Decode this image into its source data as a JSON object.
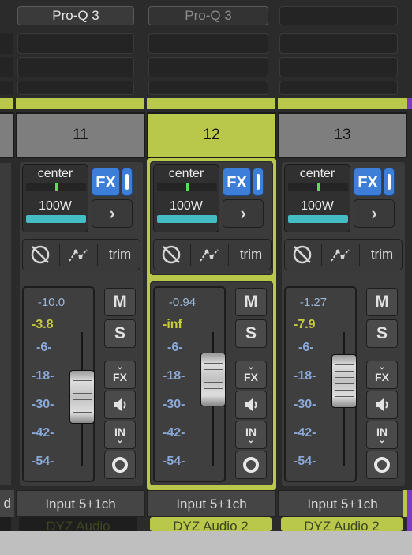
{
  "top_inserts": [
    {
      "name": "Pro-Q 3",
      "state": "active"
    },
    {
      "name": "Pro-Q 3",
      "state": "bypassed"
    }
  ],
  "channels": [
    {
      "number": "11",
      "pan": "center",
      "volume": "100W",
      "peak": "-10.0",
      "rms": "-3.8",
      "rms_color": "#c6cc3a",
      "input": "Input 5+1ch",
      "selected": false,
      "bottom_send": "DYZ Audio"
    },
    {
      "number": "12",
      "pan": "center",
      "volume": "100W",
      "peak": "-0.94",
      "rms": "-inf",
      "rms_color": "#c6cc3a",
      "input": "Input 5+1ch",
      "selected": true,
      "bottom_send": "DYZ Audio 2"
    },
    {
      "number": "13",
      "pan": "center",
      "volume": "100W",
      "peak": "-1.27",
      "rms": "-7.9",
      "rms_color": "#c6cc3a",
      "input": "Input 5+1ch",
      "selected": false,
      "bottom_send": "DYZ Audio 2"
    }
  ],
  "fader_scale": [
    "-6-",
    "-18-",
    "-30-",
    "-42-",
    "-54-"
  ],
  "buttons": {
    "fx": "FX",
    "mute": "M",
    "solo": "S",
    "fx_small": "FX",
    "in_small": "IN",
    "trim": "trim"
  },
  "left_edge_label": "d",
  "colors": {
    "track": "#b9c74a",
    "accent_blue": "#3d7ed8",
    "meter_teal": "#44bcc4",
    "purple_edge": "#7a3cc8"
  }
}
